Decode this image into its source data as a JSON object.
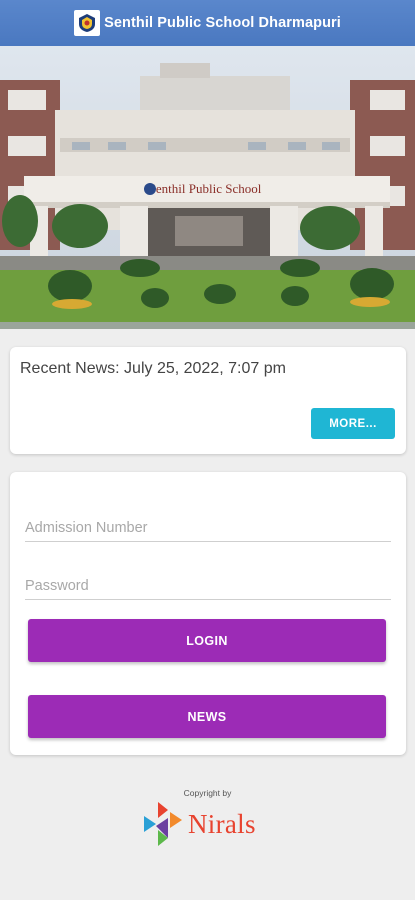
{
  "header": {
    "title": "Senthil Public School Dharmapuri",
    "logo_icon": "school-crest-icon"
  },
  "banner": {
    "building_sign": "Senthil Public School"
  },
  "news": {
    "text": "Recent News: July 25, 2022, 7:07 pm",
    "more_label": "MORE..."
  },
  "login": {
    "admission_placeholder": "Admission Number",
    "password_placeholder": "Password",
    "login_label": "LOGIN",
    "news_label": "NEWS"
  },
  "footer": {
    "copyright": "Copyright by",
    "brand": "Nirals"
  },
  "colors": {
    "header": "#4a78c0",
    "more": "#1fb6d4",
    "primary_button": "#9c2bb6",
    "brand": "#e8432f"
  }
}
